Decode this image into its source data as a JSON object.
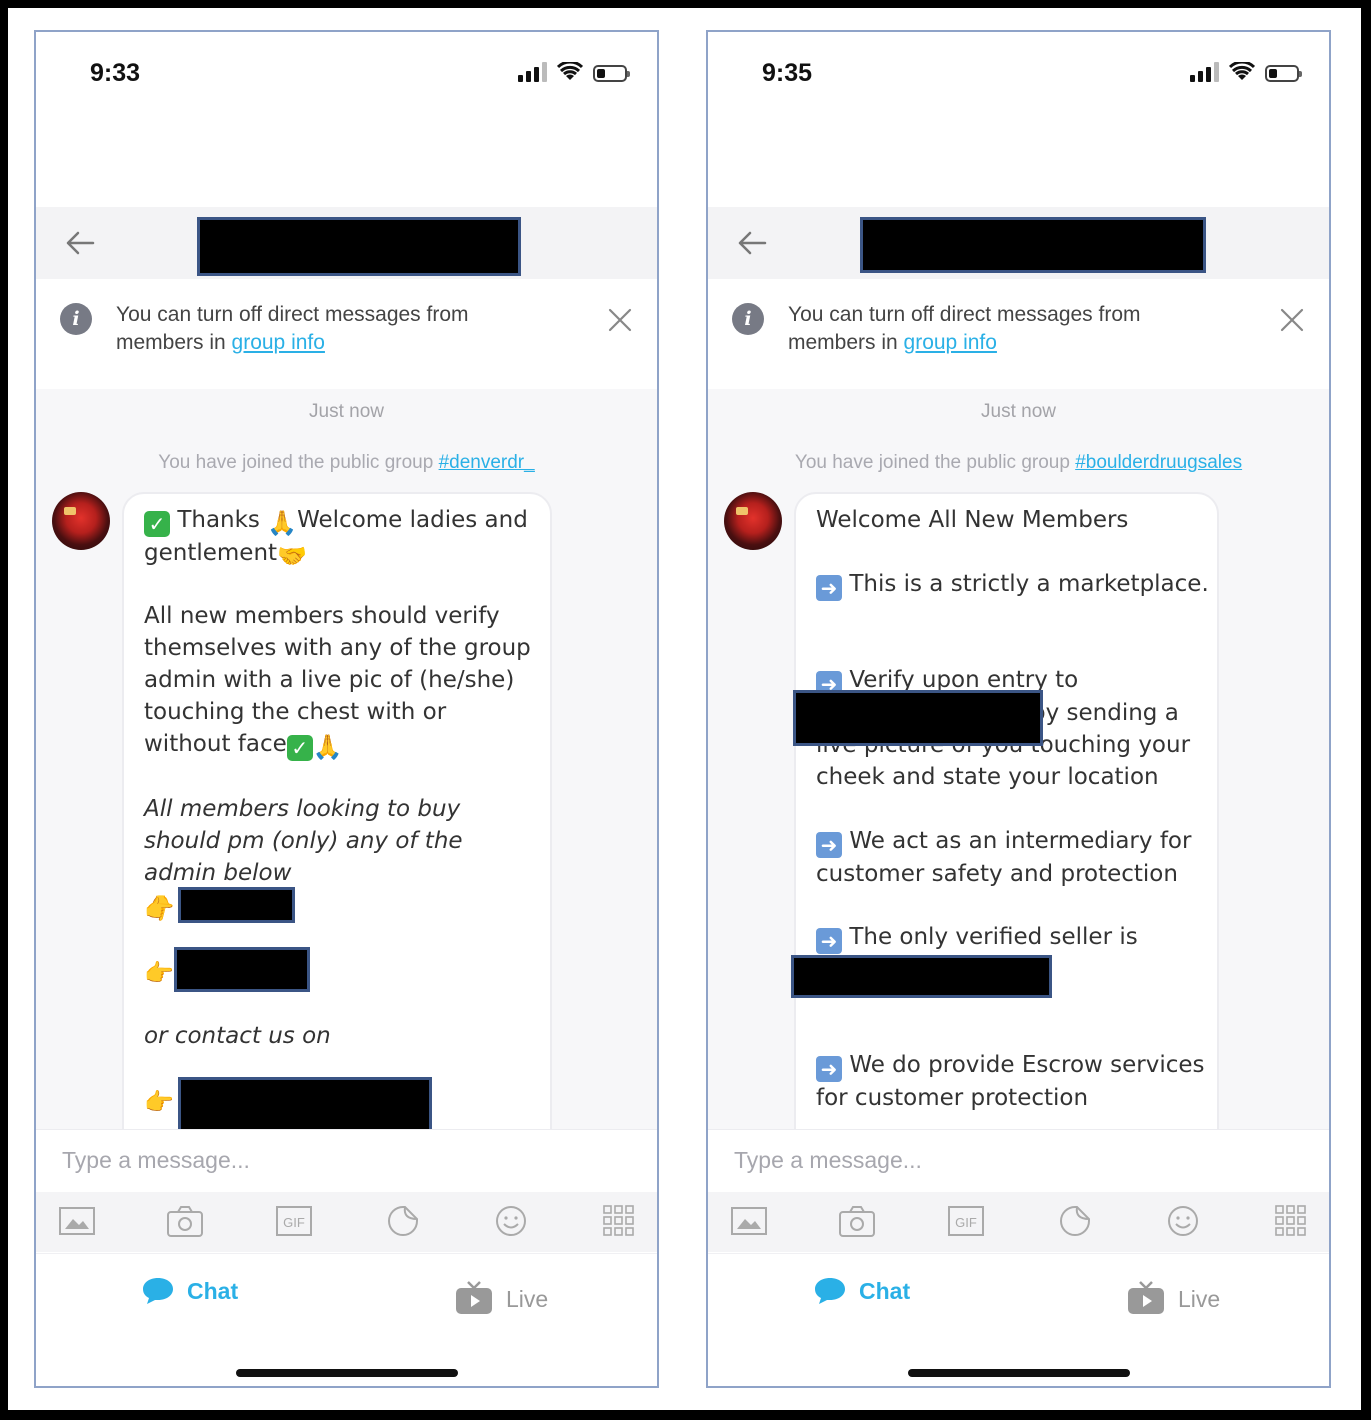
{
  "screens": [
    {
      "status_time": "9:33",
      "notice": {
        "text": "You can turn off direct messages from members in ",
        "link": "group info"
      },
      "timestamp": "Just now",
      "joined": {
        "text": "You have joined the public group ",
        "group": "#denverdr_"
      },
      "message": {
        "thanks": "Thanks",
        "welcome": "Welcome ladies and gentlement",
        "verify": "All new members should verify themselves with any of the group admin with a live pic of (he/she) touching the chest with or without face",
        "buy": "All members looking to buy should pm (only) any of the admin below",
        "contact": "or contact us on"
      },
      "input_placeholder": "Type a message...",
      "tabs": {
        "chat": "Chat",
        "live": "Live"
      },
      "gif_label": "GIF"
    },
    {
      "status_time": "9:35",
      "notice": {
        "text": "You can turn off direct messages from members in ",
        "link": "group info"
      },
      "timestamp": "Just now",
      "joined": {
        "text": "You have joined the public group ",
        "group": "#boulderdruugsales"
      },
      "message": {
        "welcome": "Welcome All New Members",
        "p1": "This is a strictly a marketplace.",
        "p2a": "Verify upon entry to",
        "p2b": "by sending a",
        "p2c": "live picture of you touching your cheek and state your location",
        "p3": "We act as an intermediary for customer safety and protection",
        "p4": "The only verified seller is",
        "p5": "We do provide Escrow services for customer protection"
      },
      "input_placeholder": "Type a message...",
      "tabs": {
        "chat": "Chat",
        "live": "Live"
      },
      "gif_label": "GIF"
    }
  ],
  "icons": [
    "back-arrow-icon",
    "info-icon",
    "close-icon",
    "image-icon",
    "camera-icon",
    "gif-icon",
    "sticker-icon",
    "emoji-icon",
    "grid-icon",
    "chat-icon",
    "live-tv-icon"
  ],
  "colors": {
    "link": "#2ab0e6",
    "redaction": "#000000",
    "redaction_border": "#3b5585"
  }
}
